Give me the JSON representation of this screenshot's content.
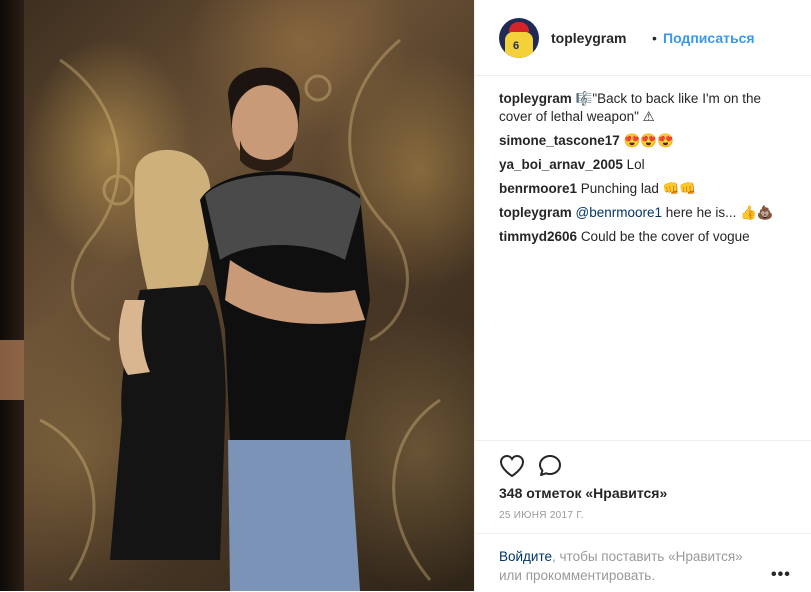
{
  "post": {
    "username": "topleygram",
    "separator": "•",
    "follow_label": "Подписаться"
  },
  "comments": [
    {
      "user": "topleygram",
      "text": "🎼\"Back to back like I'm on the cover of lethal weapon\" ⚠"
    },
    {
      "user": "simone_tascone17",
      "text": "😍😍😍"
    },
    {
      "user": "ya_boi_arnav_2005",
      "text": "Lol"
    },
    {
      "user": "benrmoore1",
      "text": "Punching lad 👊👊"
    },
    {
      "user": "topleygram",
      "mention": "@benrmoore1",
      "text": " here he is... 👍💩"
    },
    {
      "user": "timmyd2606",
      "text": "Could be the cover of vogue"
    }
  ],
  "actions": {
    "like_icon": "heart-icon",
    "comment_icon": "comment-bubble-icon"
  },
  "likes_label": "348 отметок «Нравится»",
  "date_label": "25 ИЮНЯ 2017 Г.",
  "login": {
    "link": "Войдите",
    "rest": ", чтобы поставить «Нравится» или прокомментировать."
  },
  "more_label": "•••",
  "colors": {
    "accent": "#3897f0",
    "link": "#003569",
    "muted": "#999999",
    "text": "#262626"
  }
}
